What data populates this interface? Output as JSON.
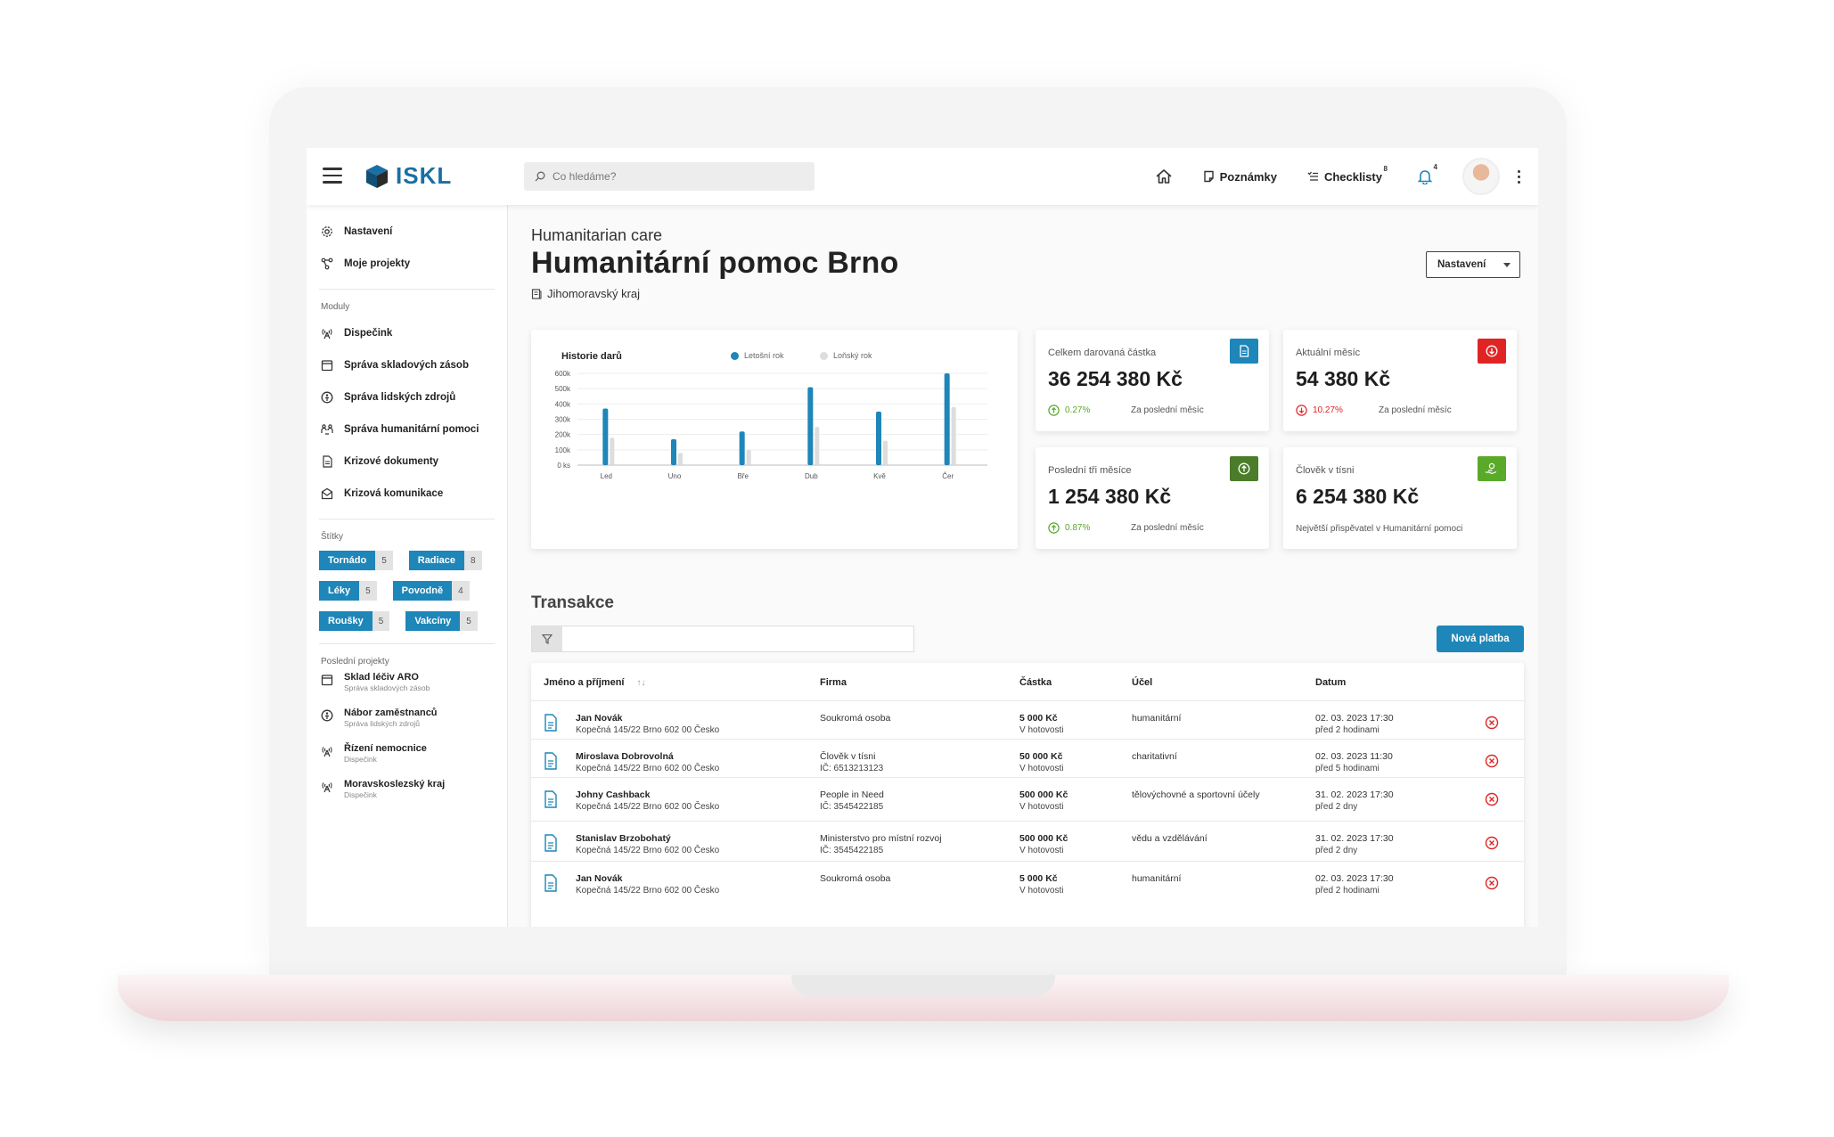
{
  "app": {
    "logo": "ISKL"
  },
  "header": {
    "search_placeholder": "Co hledáme?",
    "notes_label": "Poznámky",
    "checklists_label": "Checklisty",
    "checklists_count": "8",
    "notifications_count": "4"
  },
  "sidebar": {
    "top_items": [
      {
        "label": "Nastavení",
        "icon": "gear-icon"
      },
      {
        "label": "Moje projekty",
        "icon": "nodes-icon"
      }
    ],
    "modules_label": "Moduly",
    "modules": [
      {
        "label": "Dispečink",
        "icon": "antenna-icon"
      },
      {
        "label": "Správa skladových zásob",
        "icon": "box-icon"
      },
      {
        "label": "Správa lidských zdrojů",
        "icon": "person-circle-icon"
      },
      {
        "label": "Správa humanitární pomoci",
        "icon": "people-icon"
      },
      {
        "label": "Krizové dokumenty",
        "icon": "document-icon"
      },
      {
        "label": "Krizová komunikace",
        "icon": "mail-icon"
      }
    ],
    "tags_label": "Štítky",
    "tags": [
      {
        "name": "Tornádo",
        "count": "5"
      },
      {
        "name": "Radiace",
        "count": "8"
      },
      {
        "name": "Léky",
        "count": "5"
      },
      {
        "name": "Povodně",
        "count": "4"
      },
      {
        "name": "Roušky",
        "count": "5"
      },
      {
        "name": "Vakcíny",
        "count": "5"
      }
    ],
    "recent_label": "Poslední projekty",
    "recent": [
      {
        "title": "Sklad léčiv ARO",
        "subtitle": "Správa skladových zásob",
        "icon": "box-icon"
      },
      {
        "title": "Nábor zaměstnanců",
        "subtitle": "Správa lidských zdrojů",
        "icon": "person-circle-icon"
      },
      {
        "title": "Řízení nemocnice",
        "subtitle": "Dispečink",
        "icon": "antenna-icon"
      },
      {
        "title": "Moravskoslezský kraj",
        "subtitle": "Dispečink",
        "icon": "antenna-icon"
      }
    ]
  },
  "page": {
    "subtitle": "Humanitarian care",
    "title": "Humanitární pomoc Brno",
    "region": "Jihomoravský kraj",
    "settings_button": "Nastavení"
  },
  "chart_data": {
    "type": "bar",
    "title": "Historie darů",
    "categories": [
      "Led",
      "Uno",
      "Bře",
      "Dub",
      "Kvě",
      "Čer"
    ],
    "series": [
      {
        "name": "Letošní rok",
        "color": "#1e86b8",
        "values": [
          370000,
          170000,
          220000,
          510000,
          350000,
          600000
        ]
      },
      {
        "name": "Loňský rok",
        "color": "#dddddd",
        "values": [
          180000,
          80000,
          100000,
          250000,
          160000,
          380000
        ]
      }
    ],
    "y_ticks": [
      "0 ks",
      "100k",
      "200k",
      "300k",
      "400k",
      "500k",
      "600k"
    ],
    "ylim": [
      0,
      600000
    ],
    "legend_position": "top-right",
    "grid": true
  },
  "stats": [
    {
      "label": "Celkem darovaná částka",
      "value": "36 254 380 Kč",
      "percent": "0.27%",
      "period": "Za poslední měsíc",
      "trend": "up",
      "icon": "document-icon",
      "color": "#1e86b8"
    },
    {
      "label": "Aktuální měsíc",
      "value": "54 380 Kč",
      "percent": "10.27%",
      "period": "Za poslední měsíc",
      "trend": "down",
      "icon": "arrow-down-circle-icon",
      "color": "#e02424"
    },
    {
      "label": "Poslední tři měsíce",
      "value": "1 254 380 Kč",
      "percent": "0.87%",
      "period": "Za poslední měsíc",
      "trend": "up",
      "icon": "arrow-up-circle-icon",
      "color": "#4a7c2a"
    },
    {
      "label": "Člověk v tísni",
      "value": "6 254 380 Kč",
      "note": "Největší přispěvatel v Humanitární pomoci",
      "icon": "donate-icon",
      "color": "#5aaa2a"
    }
  ],
  "transactions": {
    "title": "Transakce",
    "new_payment_button": "Nová platba",
    "columns": [
      "Jméno a příjmení",
      "Firma",
      "Částka",
      "Účel",
      "Datum"
    ],
    "rows": [
      {
        "name": "Jan Novák",
        "address": "Kopečná 145/22 Brno 602 00 Česko",
        "company": "Soukromá osoba",
        "company_id": "",
        "amount": "5 000 Kč",
        "method": "V hotovosti",
        "purpose": "humanitární",
        "date": "02. 03. 2023  17:30",
        "ago": "před 2 hodinami"
      },
      {
        "name": "Miroslava Dobrovolná",
        "address": "Kopečná 145/22 Brno 602 00 Česko",
        "company": "Člověk v tísni",
        "company_id": "IČ: 6513213123",
        "amount": "50 000 Kč",
        "method": "V hotovosti",
        "purpose": "charitativní",
        "date": "02. 03. 2023  11:30",
        "ago": "před 5 hodinami"
      },
      {
        "name": "Johny Cashback",
        "address": "Kopečná 145/22 Brno 602 00 Česko",
        "company": "People in Need",
        "company_id": "IČ: 3545422185",
        "amount": "500 000 Kč",
        "method": "V hotovosti",
        "purpose": "tělovýchovné a sportovní účely",
        "date": "31. 02. 2023  17:30",
        "ago": "před 2 dny"
      },
      {
        "name": "Stanislav Brzobohatý",
        "address": "Kopečná 145/22 Brno 602 00 Česko",
        "company": "Ministerstvo pro místní rozvoj",
        "company_id": "IČ: 3545422185",
        "amount": "500 000 Kč",
        "method": "V hotovosti",
        "purpose": "vědu a vzdělávání",
        "date": "31. 02. 2023  17:30",
        "ago": "před 2 dny"
      },
      {
        "name": "Jan Novák",
        "address": "Kopečná 145/22 Brno 602 00 Česko",
        "company": "Soukromá osoba",
        "company_id": "",
        "amount": "5 000 Kč",
        "method": "V hotovosti",
        "purpose": "humanitární",
        "date": "02. 03. 2023  17:30",
        "ago": "před 2 hodinami"
      }
    ]
  }
}
